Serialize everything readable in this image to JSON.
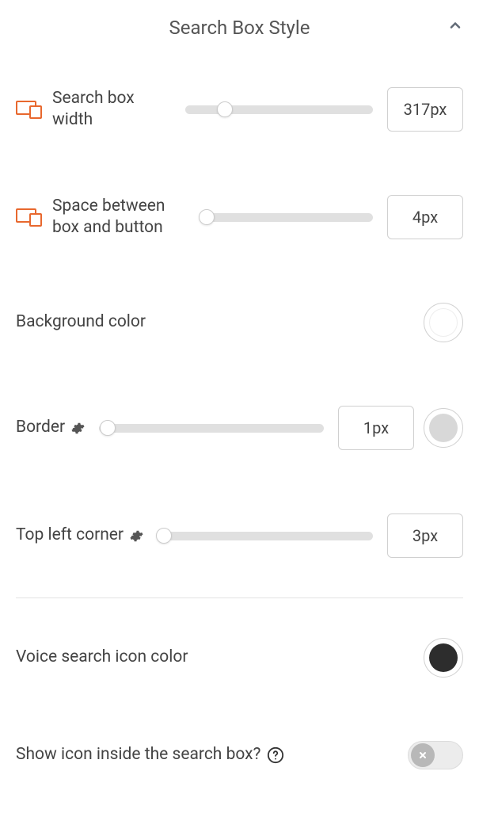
{
  "header": {
    "title": "Search Box Style"
  },
  "rows": {
    "width": {
      "label": "Search box width",
      "value": "317px",
      "slider_percent": 21
    },
    "space": {
      "label": "Space between box and button",
      "value": "4px",
      "slider_percent": 3
    },
    "background": {
      "label": "Background color",
      "color": "#ffffff"
    },
    "border": {
      "label": "Border",
      "value": "1px",
      "slider_percent": 4,
      "color": "#d8d8d8"
    },
    "corner": {
      "label": "Top left corner",
      "value": "3px",
      "slider_percent": 3
    },
    "voice": {
      "label": "Voice search icon color",
      "color": "#2d2d2d"
    },
    "show_icon": {
      "label": "Show icon inside the search box?",
      "toggled": false
    }
  }
}
